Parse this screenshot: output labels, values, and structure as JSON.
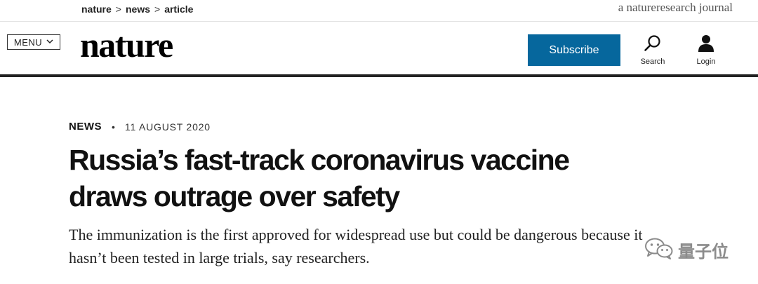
{
  "breadcrumb": {
    "items": [
      "nature",
      "news",
      "article"
    ],
    "separator": ">"
  },
  "journal_tag": "a natureresearch journal",
  "header": {
    "menu_label": "MENU",
    "logo": "nature",
    "subscribe_label": "Subscribe",
    "search_label": "Search",
    "login_label": "Login",
    "subscribe_color": "#06679d"
  },
  "article": {
    "type": "NEWS",
    "date": "11 AUGUST 2020",
    "headline": "Russia’s fast-track coronavirus vaccine draws outrage over safety",
    "standfirst": "The immunization is the first approved for widespread use but could be dangerous because it hasn’t been tested in large trials, say researchers."
  },
  "watermark": {
    "text": "量子位",
    "icon": "wechat-icon"
  }
}
